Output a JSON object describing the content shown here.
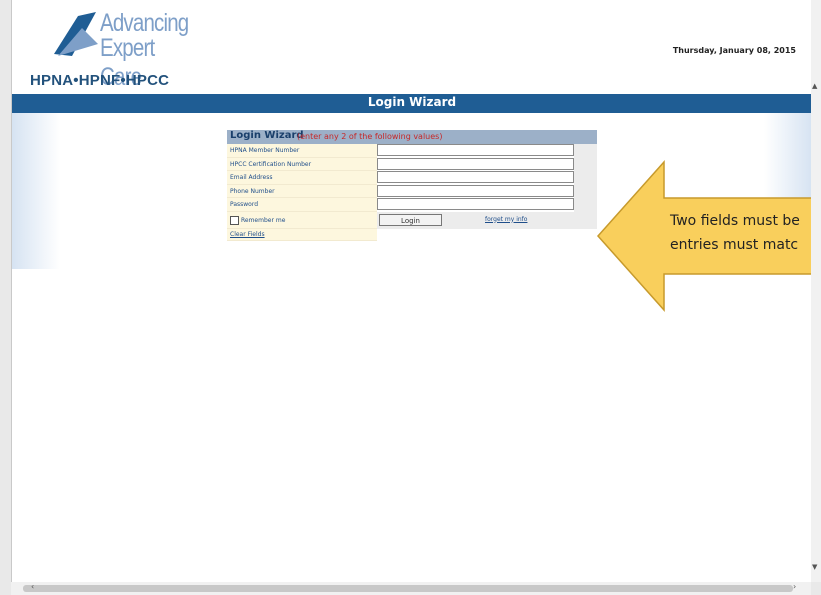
{
  "header": {
    "logo_line1": "Advancing",
    "logo_line2": "Expert Care",
    "logo_orgs": "HPNA•HPNF•HPCC",
    "date": "Thursday, January 08, 2015"
  },
  "bar": {
    "title": "Login Wizard"
  },
  "panel": {
    "title": "Login Wizard",
    "subtitle": "(enter any 2 of the following values)",
    "fields": [
      {
        "label": "HPNA Member Number",
        "value": ""
      },
      {
        "label": "HPCC Certification Number",
        "value": ""
      },
      {
        "label": "Email Address",
        "value": ""
      },
      {
        "label": "Phone Number",
        "value": ""
      },
      {
        "label": "Password",
        "value": ""
      }
    ],
    "remember_label": "Remember me",
    "login_label": "Login",
    "forget_label": "forget my info",
    "clear_label": "Clear Fields"
  },
  "callout": {
    "line1": "Two fields must be",
    "line2": "entries must matc"
  },
  "colors": {
    "brand_blue": "#1f5d94",
    "callout_fill": "#f9cf5c",
    "error_red": "#c62828"
  }
}
